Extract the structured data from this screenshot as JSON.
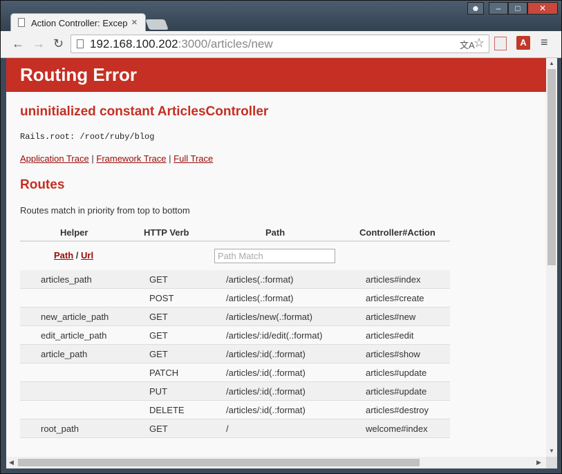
{
  "browser": {
    "tab_title": "Action Controller: Excep",
    "url_host": "192.168.100.202",
    "url_rest": ":3000/articles/new",
    "ext_label": "A"
  },
  "page": {
    "header": "Routing Error",
    "error_message": "uninitialized constant ArticlesController",
    "rails_root": "Rails.root: /root/ruby/blog",
    "traces": {
      "application": "Application Trace",
      "framework": "Framework Trace",
      "full": "Full Trace",
      "separator": "|"
    },
    "routes_title": "Routes",
    "routes_desc": "Routes match in priority from top to bottom",
    "table": {
      "headers": {
        "helper": "Helper",
        "verb": "HTTP Verb",
        "path": "Path",
        "action": "Controller#Action"
      },
      "path_link": "Path",
      "slash": "/",
      "url_link": "Url",
      "search_placeholder": "Path Match",
      "rows": [
        {
          "helper": "articles_path",
          "verb": "GET",
          "path": "/articles(.:format)",
          "action": "articles#index"
        },
        {
          "helper": "",
          "verb": "POST",
          "path": "/articles(.:format)",
          "action": "articles#create"
        },
        {
          "helper": "new_article_path",
          "verb": "GET",
          "path": "/articles/new(.:format)",
          "action": "articles#new"
        },
        {
          "helper": "edit_article_path",
          "verb": "GET",
          "path": "/articles/:id/edit(.:format)",
          "action": "articles#edit"
        },
        {
          "helper": "article_path",
          "verb": "GET",
          "path": "/articles/:id(.:format)",
          "action": "articles#show"
        },
        {
          "helper": "",
          "verb": "PATCH",
          "path": "/articles/:id(.:format)",
          "action": "articles#update"
        },
        {
          "helper": "",
          "verb": "PUT",
          "path": "/articles/:id(.:format)",
          "action": "articles#update"
        },
        {
          "helper": "",
          "verb": "DELETE",
          "path": "/articles/:id(.:format)",
          "action": "articles#destroy"
        },
        {
          "helper": "root_path",
          "verb": "GET",
          "path": "/",
          "action": "welcome#index"
        }
      ]
    }
  },
  "colors": {
    "accent": "#c52f24",
    "link": "#980905"
  }
}
